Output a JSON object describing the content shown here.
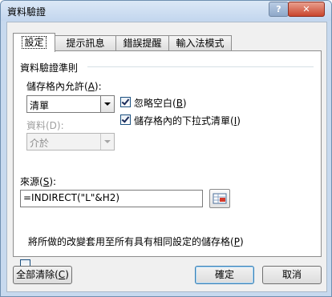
{
  "window": {
    "title": "資料驗證",
    "help_label": "?",
    "close_label": "✕"
  },
  "tabs": [
    {
      "label": "設定",
      "active": true
    },
    {
      "label": "提示訊息",
      "active": false
    },
    {
      "label": "錯誤提醒",
      "active": false
    },
    {
      "label": "輸入法模式",
      "active": false
    }
  ],
  "criteria": {
    "group_label": "資料驗證準則",
    "allow": {
      "label": "儲存格內允許(",
      "key": "A",
      "suffix": "):",
      "value": "清單"
    },
    "data": {
      "label": "資料(D):",
      "value": "介於"
    },
    "ignore_blank": {
      "label": "忽略空白(",
      "key": "B",
      "suffix": ")",
      "checked": true
    },
    "in_cell_dropdown": {
      "label": "儲存格內的下拉式清單(",
      "key": "I",
      "suffix": ")",
      "checked": true
    },
    "source": {
      "label": "來源(",
      "key": "S",
      "suffix": "):",
      "value": "=INDIRECT(\"L\"&H2)"
    }
  },
  "apply_all": {
    "label": "將所做的改變套用至所有具有相同設定的儲存格(",
    "key": "P",
    "suffix": ")",
    "checked": false
  },
  "buttons": {
    "clear_all": {
      "label": "全部清除(",
      "key": "C",
      "suffix": ")"
    },
    "ok": "確定",
    "cancel": "取消"
  },
  "icons": {
    "help": "help-icon",
    "close": "close-icon",
    "range_picker": "range-picker-icon",
    "dropdown": "chevron-down-icon"
  }
}
